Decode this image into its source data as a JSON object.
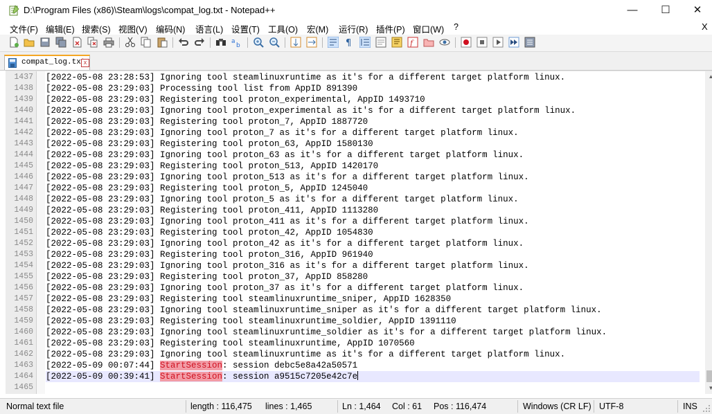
{
  "window": {
    "title": "D:\\Program Files (x86)\\Steam\\logs\\compat_log.txt - Notepad++",
    "minimize": "—",
    "maximize": "☐",
    "close": "✕"
  },
  "menu": {
    "items": [
      "文件(F)",
      "编辑(E)",
      "搜索(S)",
      "视图(V)",
      "编码(N)",
      "语言(L)",
      "设置(T)",
      "工具(O)",
      "宏(M)",
      "运行(R)",
      "插件(P)",
      "窗口(W)",
      "?"
    ],
    "close_label": "X"
  },
  "toolbar": {
    "icons": [
      "new-file-icon",
      "open-file-icon",
      "save-icon",
      "save-all-icon",
      "close-icon",
      "close-all-icon",
      "print-icon",
      "cut-icon",
      "copy-icon",
      "paste-icon",
      "undo-icon",
      "redo-icon",
      "find-icon",
      "replace-icon",
      "zoom-in-icon",
      "zoom-out-icon",
      "sync-vertical-icon",
      "sync-horizontal-icon",
      "word-wrap-icon",
      "show-all-chars-icon",
      "indent-guide-icon",
      "udl-icon",
      "doc-map-icon",
      "function-list-icon",
      "folder-workspace-icon",
      "monitoring-icon",
      "macro-record-icon",
      "macro-stop-icon",
      "macro-play-icon",
      "macro-run-multiple-icon",
      "macro-save-icon"
    ]
  },
  "tab": {
    "label": "compat_log.txt",
    "close_symbol": "x"
  },
  "editor": {
    "lines": [
      {
        "num": "1437",
        "text": "[2022-05-08 23:28:53] Ignoring tool steamlinuxruntime as it's for a different target platform linux."
      },
      {
        "num": "1438",
        "text": "[2022-05-08 23:29:03] Processing tool list from AppID 891390"
      },
      {
        "num": "1439",
        "text": "[2022-05-08 23:29:03] Registering tool proton_experimental, AppID 1493710"
      },
      {
        "num": "1440",
        "text": "[2022-05-08 23:29:03] Ignoring tool proton_experimental as it's for a different target platform linux."
      },
      {
        "num": "1441",
        "text": "[2022-05-08 23:29:03] Registering tool proton_7, AppID 1887720"
      },
      {
        "num": "1442",
        "text": "[2022-05-08 23:29:03] Ignoring tool proton_7 as it's for a different target platform linux."
      },
      {
        "num": "1443",
        "text": "[2022-05-08 23:29:03] Registering tool proton_63, AppID 1580130"
      },
      {
        "num": "1444",
        "text": "[2022-05-08 23:29:03] Ignoring tool proton_63 as it's for a different target platform linux."
      },
      {
        "num": "1445",
        "text": "[2022-05-08 23:29:03] Registering tool proton_513, AppID 1420170"
      },
      {
        "num": "1446",
        "text": "[2022-05-08 23:29:03] Ignoring tool proton_513 as it's for a different target platform linux."
      },
      {
        "num": "1447",
        "text": "[2022-05-08 23:29:03] Registering tool proton_5, AppID 1245040"
      },
      {
        "num": "1448",
        "text": "[2022-05-08 23:29:03] Ignoring tool proton_5 as it's for a different target platform linux."
      },
      {
        "num": "1449",
        "text": "[2022-05-08 23:29:03] Registering tool proton_411, AppID 1113280"
      },
      {
        "num": "1450",
        "text": "[2022-05-08 23:29:03] Ignoring tool proton_411 as it's for a different target platform linux."
      },
      {
        "num": "1451",
        "text": "[2022-05-08 23:29:03] Registering tool proton_42, AppID 1054830"
      },
      {
        "num": "1452",
        "text": "[2022-05-08 23:29:03] Ignoring tool proton_42 as it's for a different target platform linux."
      },
      {
        "num": "1453",
        "text": "[2022-05-08 23:29:03] Registering tool proton_316, AppID 961940"
      },
      {
        "num": "1454",
        "text": "[2022-05-08 23:29:03] Ignoring tool proton_316 as it's for a different target platform linux."
      },
      {
        "num": "1455",
        "text": "[2022-05-08 23:29:03] Registering tool proton_37, AppID 858280"
      },
      {
        "num": "1456",
        "text": "[2022-05-08 23:29:03] Ignoring tool proton_37 as it's for a different target platform linux."
      },
      {
        "num": "1457",
        "text": "[2022-05-08 23:29:03] Registering tool steamlinuxruntime_sniper, AppID 1628350"
      },
      {
        "num": "1458",
        "text": "[2022-05-08 23:29:03] Ignoring tool steamlinuxruntime_sniper as it's for a different target platform linux."
      },
      {
        "num": "1459",
        "text": "[2022-05-08 23:29:03] Registering tool steamlinuxruntime_soldier, AppID 1391110"
      },
      {
        "num": "1460",
        "text": "[2022-05-08 23:29:03] Ignoring tool steamlinuxruntime_soldier as it's for a different target platform linux."
      },
      {
        "num": "1461",
        "text": "[2022-05-08 23:29:03] Registering tool steamlinuxruntime, AppID 1070560"
      },
      {
        "num": "1462",
        "text": "[2022-05-08 23:29:03] Ignoring tool steamlinuxruntime as it's for a different target platform linux."
      },
      {
        "num": "1463",
        "text": "[2022-05-09 00:07:44] ",
        "highlight": "StartSession",
        "rest": ": session debc5e8a42a50571"
      },
      {
        "num": "1464",
        "text": "[2022-05-09 00:39:41] ",
        "highlight": "StartSession",
        "rest": ": session a9515c7205e42c7e",
        "current": true
      },
      {
        "num": "1465",
        "text": ""
      }
    ],
    "current_line_color": "#e8e8ff",
    "highlight_color": "#f29ca6"
  },
  "status": {
    "file_type": "Normal text file",
    "length": "length : 116,475",
    "lines": "lines : 1,465",
    "ln": "Ln : 1,464",
    "col": "Col : 61",
    "pos": "Pos : 116,474",
    "eol": "Windows (CR LF)",
    "encoding": "UTF-8",
    "mode": "INS"
  }
}
